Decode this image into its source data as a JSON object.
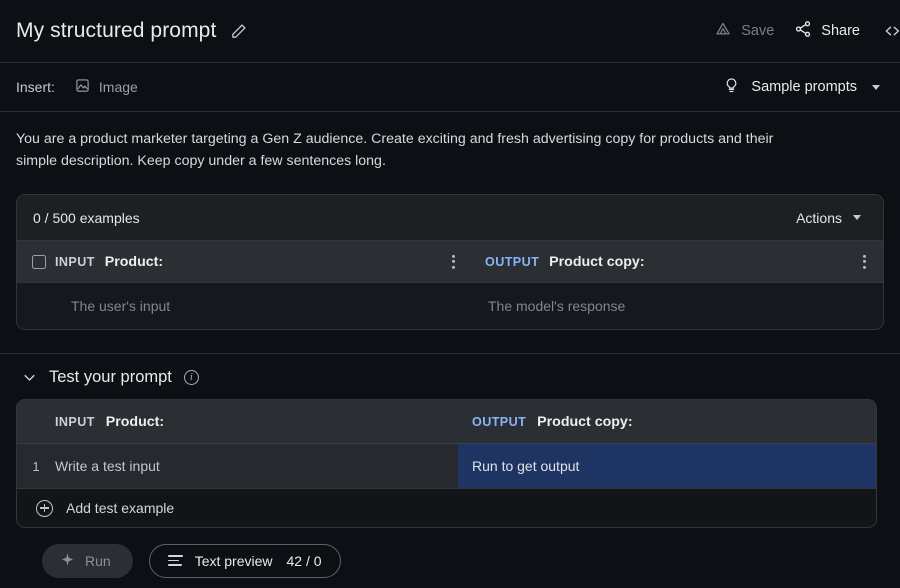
{
  "titlebar": {
    "title": "My structured prompt",
    "edit_icon": "pencil-icon",
    "save_label": "Save",
    "save_icon": "drive-triangle-icon",
    "share_label": "Share",
    "share_icon": "share-nodes-icon",
    "code_icon": "code-chevron-icon"
  },
  "insertbar": {
    "insert_label": "Insert:",
    "image_label": "Image",
    "image_icon": "image-icon",
    "sample_prompts_label": "Sample prompts",
    "bulb_icon": "lightbulb-icon",
    "caret_icon": "chevron-down-icon"
  },
  "system_prompt": {
    "text": "You are a product marketer targeting a Gen Z audience. Create exciting and fresh advertising copy for products and their simple description. Keep copy under a few sentences long."
  },
  "examples": {
    "count_label": "0 / 500 examples",
    "actions_label": "Actions",
    "input_tag": "INPUT",
    "input_column": "Product:",
    "output_tag": "OUTPUT",
    "output_column": "Product copy:",
    "input_placeholder": "The user's input",
    "output_placeholder": "The model's response",
    "kebab_icon": "more-vertical-icon",
    "checkbox_icon": "checkbox-unchecked-icon"
  },
  "test_section": {
    "title": "Test your prompt",
    "collapse_icon": "chevron-down-icon",
    "info_icon": "info-circle-icon",
    "info_glyph": "i",
    "input_tag": "INPUT",
    "input_column": "Product:",
    "output_tag": "OUTPUT",
    "output_column": "Product copy:",
    "rows": [
      {
        "number": "1",
        "input_placeholder": "Write a test input",
        "output_placeholder": "Run to get output"
      }
    ],
    "add_label": "Add test example",
    "add_icon": "plus-circle-icon"
  },
  "bottom_bar": {
    "run_label": "Run",
    "run_icon": "sparkle-icon",
    "preview_label": "Text preview",
    "preview_count": "42 / 0",
    "preview_icon": "text-lines-icon"
  },
  "colors": {
    "page_bg": "#0c0f13",
    "panel_bg": "#15181c",
    "header_row_bg": "#2b2e32",
    "output_tag": "#8ab4f8",
    "output_cell_highlight": "#1e3563",
    "border": "#32363b"
  }
}
